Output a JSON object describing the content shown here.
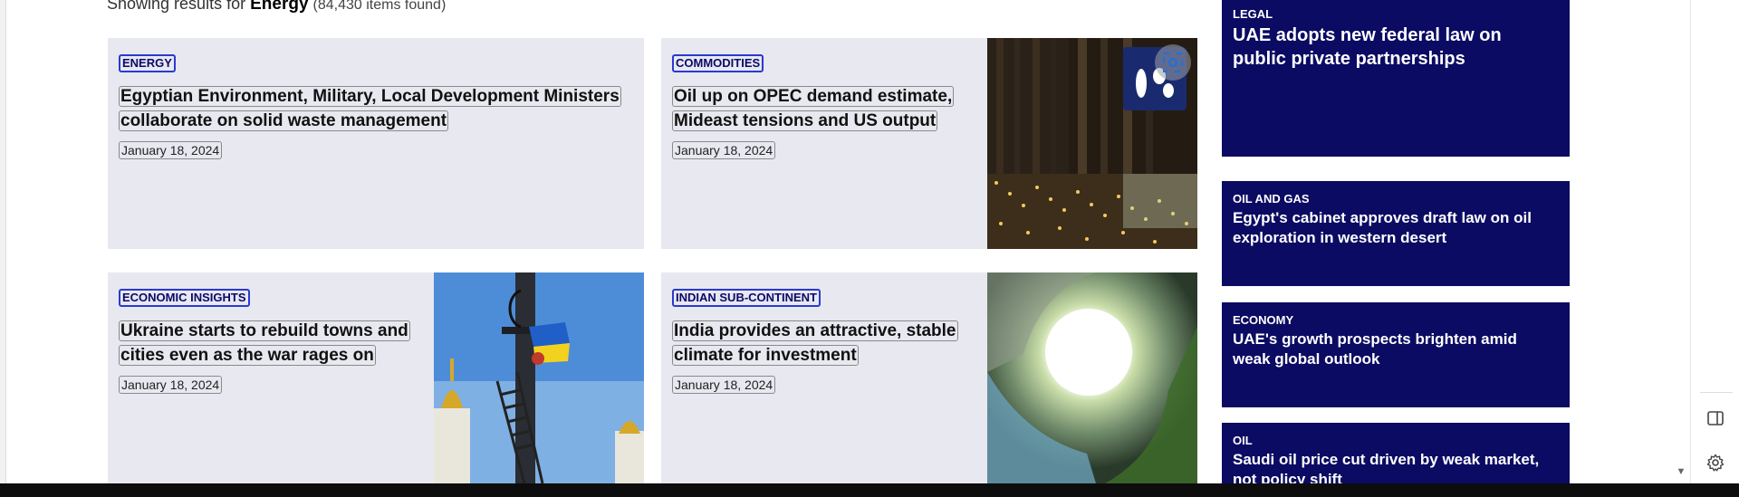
{
  "search": {
    "prefix": "Showing results for",
    "keyword": "Energy",
    "count_text": "(84,430 items found)"
  },
  "articles": [
    {
      "category": "ENERGY",
      "title": "Egyptian Environment, Military, Local Development Ministers collaborate on solid waste management",
      "date": "January 18, 2024"
    },
    {
      "category": "COMMODITIES",
      "title": "Oil up on OPEC demand estimate, Mideast tensions and US output",
      "date": "January 18, 2024",
      "image": "opec-building-photo"
    },
    {
      "category": "ECONOMIC INSIGHTS",
      "title": "Ukraine starts to rebuild towns and cities even as the war rages on",
      "date": "January 18, 2024",
      "image": "ukraine-flag-pole-photo"
    },
    {
      "category": "INDIAN SUB-CONTINENT",
      "title": "India provides an attractive, stable climate for investment",
      "date": "January 18, 2024",
      "image": "city-tunnel-photo"
    }
  ],
  "sidebar": [
    {
      "category": "LEGAL",
      "title": "UAE adopts new federal law on public private partnerships"
    },
    {
      "category": "OIL AND GAS",
      "title": "Egypt's cabinet approves draft law on oil exploration in western desert"
    },
    {
      "category": "ECONOMY",
      "title": "UAE's growth prospects brighten amid weak global outlook"
    },
    {
      "category": "OIL",
      "title": "Saudi oil price cut driven by weak market, not policy shift"
    }
  ],
  "colors": {
    "card_bg": "#e8e8f0",
    "sidebar_bg": "#0b0b63",
    "tag_border": "#2a3ad0"
  },
  "icons": {
    "rail": [
      "sidebar-panel-icon",
      "settings-gear-icon"
    ],
    "image_action": "visual-search-icon"
  }
}
